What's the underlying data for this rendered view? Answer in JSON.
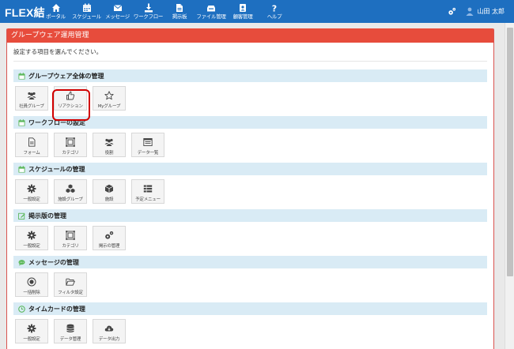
{
  "brand": "FLEX結",
  "nav": [
    {
      "label": "ポータル",
      "icon": "home-icon"
    },
    {
      "label": "スケジュール",
      "icon": "calendar-icon"
    },
    {
      "label": "メッセージ",
      "icon": "mail-icon"
    },
    {
      "label": "ワークフロー",
      "icon": "download-icon"
    },
    {
      "label": "掲示板",
      "icon": "bulletin-icon"
    },
    {
      "label": "ファイル管理",
      "icon": "folder-icon"
    },
    {
      "label": "顧客管理",
      "icon": "address-book-icon"
    },
    {
      "label": "ヘルプ",
      "icon": "help-icon"
    }
  ],
  "user": {
    "name": "山田 太郎"
  },
  "panel": {
    "title": "グループウェア運用管理",
    "instruction": "設定する項目を選んでください。"
  },
  "sections": [
    {
      "title": "グループウェア全体の管理",
      "icon": "calendar-icon",
      "tiles": [
        {
          "label": "社員グループ",
          "icon": "users-icon"
        },
        {
          "label": "リアクション",
          "icon": "thumbs-up-icon"
        },
        {
          "label": "Myグループ",
          "icon": "star-icon"
        }
      ]
    },
    {
      "title": "ワークフローの設定",
      "icon": "calendar-icon",
      "tiles": [
        {
          "label": "フォーム",
          "icon": "file-icon"
        },
        {
          "label": "カテゴリ",
          "icon": "category-icon"
        },
        {
          "label": "役割",
          "icon": "users-icon"
        },
        {
          "label": "データ一覧",
          "icon": "list-icon"
        }
      ]
    },
    {
      "title": "スケジュールの管理",
      "icon": "calendar-icon",
      "tiles": [
        {
          "label": "一般設定",
          "icon": "gear-icon"
        },
        {
          "label": "施設グループ",
          "icon": "cubes-icon"
        },
        {
          "label": "施設",
          "icon": "cube-icon"
        },
        {
          "label": "予定メニュー",
          "icon": "menu-icon"
        }
      ]
    },
    {
      "title": "掲示版の管理",
      "icon": "edit-icon",
      "tiles": [
        {
          "label": "一般設定",
          "icon": "gear-icon"
        },
        {
          "label": "カテゴリ",
          "icon": "category-icon"
        },
        {
          "label": "掲示の管理",
          "icon": "gears-icon"
        }
      ]
    },
    {
      "title": "メッセージの管理",
      "icon": "chat-icon",
      "tiles": [
        {
          "label": "一括削除",
          "icon": "record-icon"
        },
        {
          "label": "フィルタ設定",
          "icon": "folder-open-icon"
        }
      ]
    },
    {
      "title": "タイムカードの管理",
      "icon": "clock-icon",
      "tiles": [
        {
          "label": "一般設定",
          "icon": "gear-icon"
        },
        {
          "label": "データ管理",
          "icon": "database-icon"
        },
        {
          "label": "データ出力",
          "icon": "cloud-download-icon"
        }
      ]
    }
  ],
  "colors": {
    "topbar": "#1e6fc0",
    "panel_header": "#e74c3c",
    "section_head": "#d9ebf5",
    "highlight": "#d10000"
  }
}
